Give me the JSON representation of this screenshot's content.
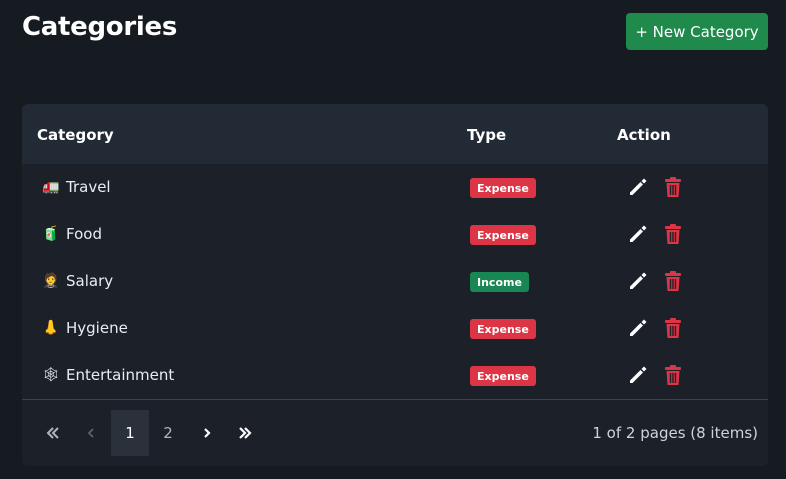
{
  "header": {
    "title": "Categories",
    "new_button_label": "+ New Category"
  },
  "table": {
    "columns": [
      "Category",
      "Type",
      "Action"
    ],
    "rows": [
      {
        "emoji": "🚛",
        "name": "Travel",
        "type": "Expense"
      },
      {
        "emoji": "🧃",
        "name": "Food",
        "type": "Expense"
      },
      {
        "emoji": "🤵",
        "name": "Salary",
        "type": "Income"
      },
      {
        "emoji": "👃",
        "name": "Hygiene",
        "type": "Expense"
      },
      {
        "emoji": "🕸",
        "name": "Entertainment",
        "type": "Expense"
      }
    ]
  },
  "pagination": {
    "pages": [
      "1",
      "2"
    ],
    "current_page": "1",
    "summary": "1 of 2 pages (8 items)"
  },
  "icons": {
    "first": "double-chevron-left-icon",
    "prev": "chevron-left-icon",
    "next": "chevron-right-icon",
    "last": "double-chevron-right-icon",
    "edit": "pencil-icon",
    "delete": "trash-icon"
  },
  "colors": {
    "background": "#161b22",
    "primary_button": "#1f8a4c",
    "expense_badge": "#dc3545",
    "income_badge": "#198754",
    "delete_icon": "#dc3545"
  }
}
